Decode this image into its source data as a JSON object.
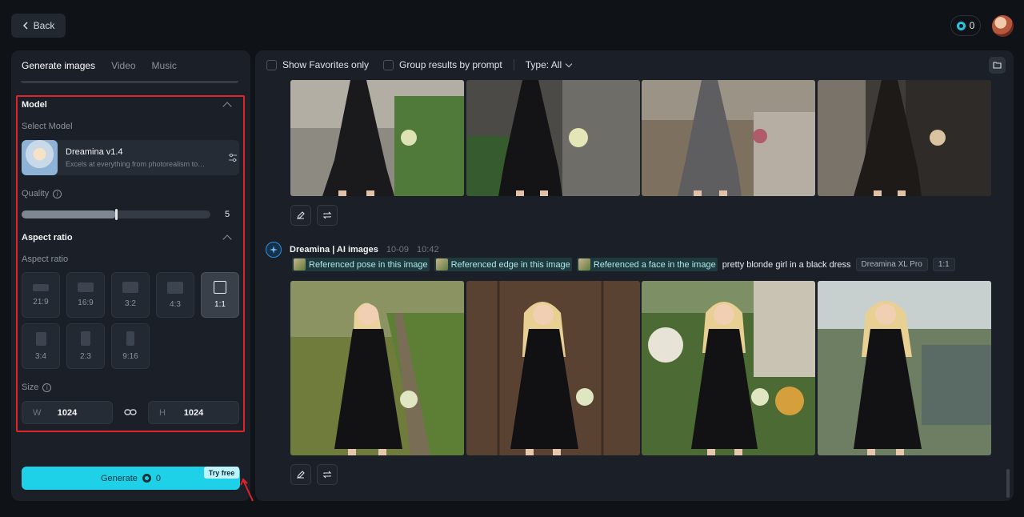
{
  "header": {
    "back_label": "Back",
    "credits": "0"
  },
  "left_panel": {
    "tabs": [
      {
        "label": "Generate images",
        "active": true
      },
      {
        "label": "Video",
        "active": false
      },
      {
        "label": "Music",
        "active": false
      }
    ],
    "model_section": {
      "title": "Model",
      "select_label": "Select Model",
      "model_name": "Dreamina v1.4",
      "model_desc": "Excels at everything from photorealism to painterly styles"
    },
    "quality": {
      "label": "Quality",
      "value": "5",
      "fraction": 0.5
    },
    "aspect_section": {
      "title": "Aspect ratio",
      "label": "Aspect ratio",
      "ratios": [
        {
          "label": "21:9",
          "active": false
        },
        {
          "label": "16:9",
          "active": false
        },
        {
          "label": "3:2",
          "active": false
        },
        {
          "label": "4:3",
          "active": false
        },
        {
          "label": "1:1",
          "active": true
        },
        {
          "label": "3:4",
          "active": false
        },
        {
          "label": "2:3",
          "active": false
        },
        {
          "label": "9:16",
          "active": false
        }
      ]
    },
    "size": {
      "label": "Size",
      "w_letter": "W",
      "w_value": "1024",
      "h_letter": "H",
      "h_value": "1024"
    },
    "generate": {
      "label": "Generate",
      "cost": "0",
      "badge": "Try free"
    },
    "highlight_color": "#e0222b"
  },
  "right_panel": {
    "toolbar": {
      "favorites_label": "Show Favorites only",
      "group_label": "Group results by prompt",
      "type_label": "Type: All"
    },
    "generation": {
      "title": "Dreamina | AI images",
      "date": "10-09",
      "time": "10:42",
      "refs": [
        "Referenced pose in this image",
        "Referenced edge in this image",
        "Referenced a face in the image"
      ],
      "prompt": "pretty blonde girl in a black dress",
      "model_tag": "Dreamina XL Pro",
      "ratio_tag": "1:1"
    }
  },
  "accent_color": "#1fd1e8"
}
